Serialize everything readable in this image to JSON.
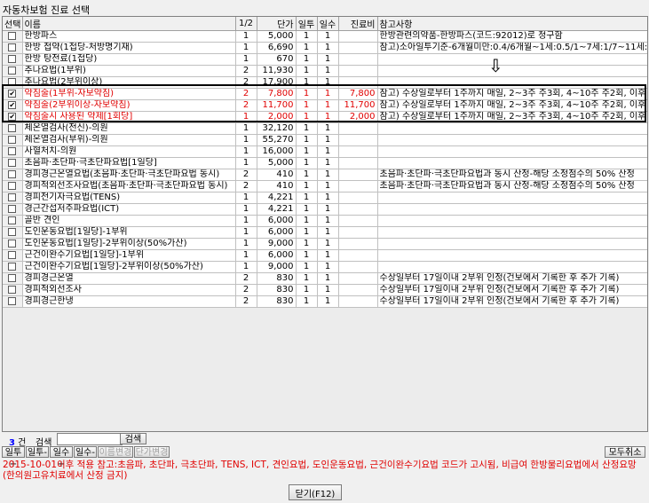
{
  "window": {
    "title": "자동차보험 진료 선택"
  },
  "grid": {
    "headers": {
      "select": "선택",
      "name": "이름",
      "ratio": "1/2",
      "price": "단가",
      "times": "일투",
      "days": "일수",
      "fee": "진료비",
      "note": "참고사항"
    },
    "rows": [
      {
        "checked": false,
        "sel": false,
        "name": "한방파스",
        "ratio": "1",
        "price": "5,000",
        "times": "1",
        "days": "1",
        "fee": "",
        "note": "한방관련의약품-한방파스(코드:92012)로 청구함"
      },
      {
        "checked": false,
        "sel": false,
        "name": "한방 첩약(1첩당-처방명기재)",
        "ratio": "1",
        "price": "6,690",
        "times": "1",
        "days": "1",
        "fee": "",
        "note": "참고)소아일투기준-6개월미만:0.4/6개월~1세:0.5/1~7세:1/7~11세:1.5"
      },
      {
        "checked": false,
        "sel": false,
        "name": "한방 탕전료(1첩당)",
        "ratio": "1",
        "price": "670",
        "times": "1",
        "days": "1",
        "fee": "",
        "note": ""
      },
      {
        "checked": false,
        "sel": false,
        "name": "추나요법(1부위)",
        "ratio": "2",
        "price": "11,930",
        "times": "1",
        "days": "1",
        "fee": "",
        "note": ""
      },
      {
        "checked": false,
        "sel": false,
        "name": "추나요법(2부위이상)",
        "ratio": "2",
        "price": "17,900",
        "times": "1",
        "days": "1",
        "fee": "",
        "note": ""
      },
      {
        "checked": true,
        "sel": true,
        "name": "약침술(1부위-자보약침)",
        "ratio": "2",
        "price": "7,800",
        "times": "1",
        "days": "1",
        "fee": "7,800",
        "note": "참고) 수상일로부터 1주까지 매일, 2~3주 주3회, 4~10주 주2회, 이후 주1회"
      },
      {
        "checked": true,
        "sel": true,
        "name": "약침술(2부위이상-자보약침)",
        "ratio": "2",
        "price": "11,700",
        "times": "1",
        "days": "1",
        "fee": "11,700",
        "note": "참고) 수상일로부터 1주까지 매일, 2~3주 주3회, 4~10주 주2회, 이후 주1회"
      },
      {
        "checked": true,
        "sel": true,
        "name": "약침술시 사용된 약제[1회당]",
        "ratio": "1",
        "price": "2,000",
        "times": "1",
        "days": "1",
        "fee": "2,000",
        "note": "참고) 수상일로부터 1주까지 매일, 2~3주 주3회, 4~10주 주2회, 이후 주1회"
      },
      {
        "checked": false,
        "sel": false,
        "name": "체온열검사(전신)-의원",
        "ratio": "1",
        "price": "32,120",
        "times": "1",
        "days": "1",
        "fee": "",
        "note": ""
      },
      {
        "checked": false,
        "sel": false,
        "name": "체온열검사(부위)-의원",
        "ratio": "1",
        "price": "55,270",
        "times": "1",
        "days": "1",
        "fee": "",
        "note": ""
      },
      {
        "checked": false,
        "sel": false,
        "name": "사혈처치-의원",
        "ratio": "1",
        "price": "16,000",
        "times": "1",
        "days": "1",
        "fee": "",
        "note": ""
      },
      {
        "checked": false,
        "sel": false,
        "name": "초음파·초단파·극초단파요법[1일당]",
        "ratio": "1",
        "price": "5,000",
        "times": "1",
        "days": "1",
        "fee": "",
        "note": ""
      },
      {
        "checked": false,
        "sel": false,
        "name": "경피경근온열요법(초음파·초단파·극초단파요법 동시)",
        "ratio": "2",
        "price": "410",
        "times": "1",
        "days": "1",
        "fee": "",
        "note": "초음파·초단파·극초단파요법과 동시 산정-해당 소정점수의 50% 산정"
      },
      {
        "checked": false,
        "sel": false,
        "name": "경피적외선조사요법(초음파·초단파·극초단파요법 동시)",
        "ratio": "2",
        "price": "410",
        "times": "1",
        "days": "1",
        "fee": "",
        "note": "초음파·초단파·극초단파요법과 동시 산정-해당 소정점수의 50% 산정"
      },
      {
        "checked": false,
        "sel": false,
        "name": "경피전기자극요법(TENS)",
        "ratio": "1",
        "price": "4,221",
        "times": "1",
        "days": "1",
        "fee": "",
        "note": ""
      },
      {
        "checked": false,
        "sel": false,
        "name": "경근간섭저주파요법(ICT)",
        "ratio": "1",
        "price": "4,221",
        "times": "1",
        "days": "1",
        "fee": "",
        "note": ""
      },
      {
        "checked": false,
        "sel": false,
        "name": "골반 견인",
        "ratio": "1",
        "price": "6,000",
        "times": "1",
        "days": "1",
        "fee": "",
        "note": ""
      },
      {
        "checked": false,
        "sel": false,
        "name": "도인운동요법[1일당]-1부위",
        "ratio": "1",
        "price": "6,000",
        "times": "1",
        "days": "1",
        "fee": "",
        "note": ""
      },
      {
        "checked": false,
        "sel": false,
        "name": "도인운동요법[1일당]-2부위이상(50%가산)",
        "ratio": "1",
        "price": "9,000",
        "times": "1",
        "days": "1",
        "fee": "",
        "note": ""
      },
      {
        "checked": false,
        "sel": false,
        "name": "근건이완수기요법[1일당]-1부위",
        "ratio": "1",
        "price": "6,000",
        "times": "1",
        "days": "1",
        "fee": "",
        "note": ""
      },
      {
        "checked": false,
        "sel": false,
        "name": "근건이완수기요법[1일당]-2부위이상(50%가산)",
        "ratio": "1",
        "price": "9,000",
        "times": "1",
        "days": "1",
        "fee": "",
        "note": ""
      },
      {
        "checked": false,
        "sel": false,
        "name": "경피경근온열",
        "ratio": "2",
        "price": "830",
        "times": "1",
        "days": "1",
        "fee": "",
        "note": "수상일부터 17일이내 2부위 인정(건보에서 기록한 후 추가 기록)"
      },
      {
        "checked": false,
        "sel": false,
        "name": "경피적외선조사",
        "ratio": "2",
        "price": "830",
        "times": "1",
        "days": "1",
        "fee": "",
        "note": "수상일부터 17일이내 2부위 인정(건보에서 기록한 후 추가 기록)"
      },
      {
        "checked": false,
        "sel": false,
        "name": "경피경근한냉",
        "ratio": "2",
        "price": "830",
        "times": "1",
        "days": "1",
        "fee": "",
        "note": "수상일부터 17일이내 2부위 인정(건보에서 기록한 후 추가 기록)"
      }
    ]
  },
  "annotation": {
    "arrow": "⇩"
  },
  "footer": {
    "count_value": "3",
    "count_unit": "건",
    "search_label": "검색",
    "search_value": "",
    "search_button": "검색",
    "btn_daily_plus": "일투+",
    "btn_daily_minus": "일투-",
    "btn_days_plus": "일수+",
    "btn_days_minus": "일수-",
    "btn_name_change": "이름변경",
    "btn_price_change": "단가변경",
    "btn_cancel_all": "모두취소",
    "notice": "2015-10-01이후 적용 참고:초음파, 초단파, 극초단파, TENS, ICT, 견인요법, 도인운동요법, 근건이완수기요법 코드가 고시됨, 비급여 한방물리요법에서 산정요망(한의원고유치료에서 산정 금지)",
    "close_button": "닫기(F12)"
  }
}
